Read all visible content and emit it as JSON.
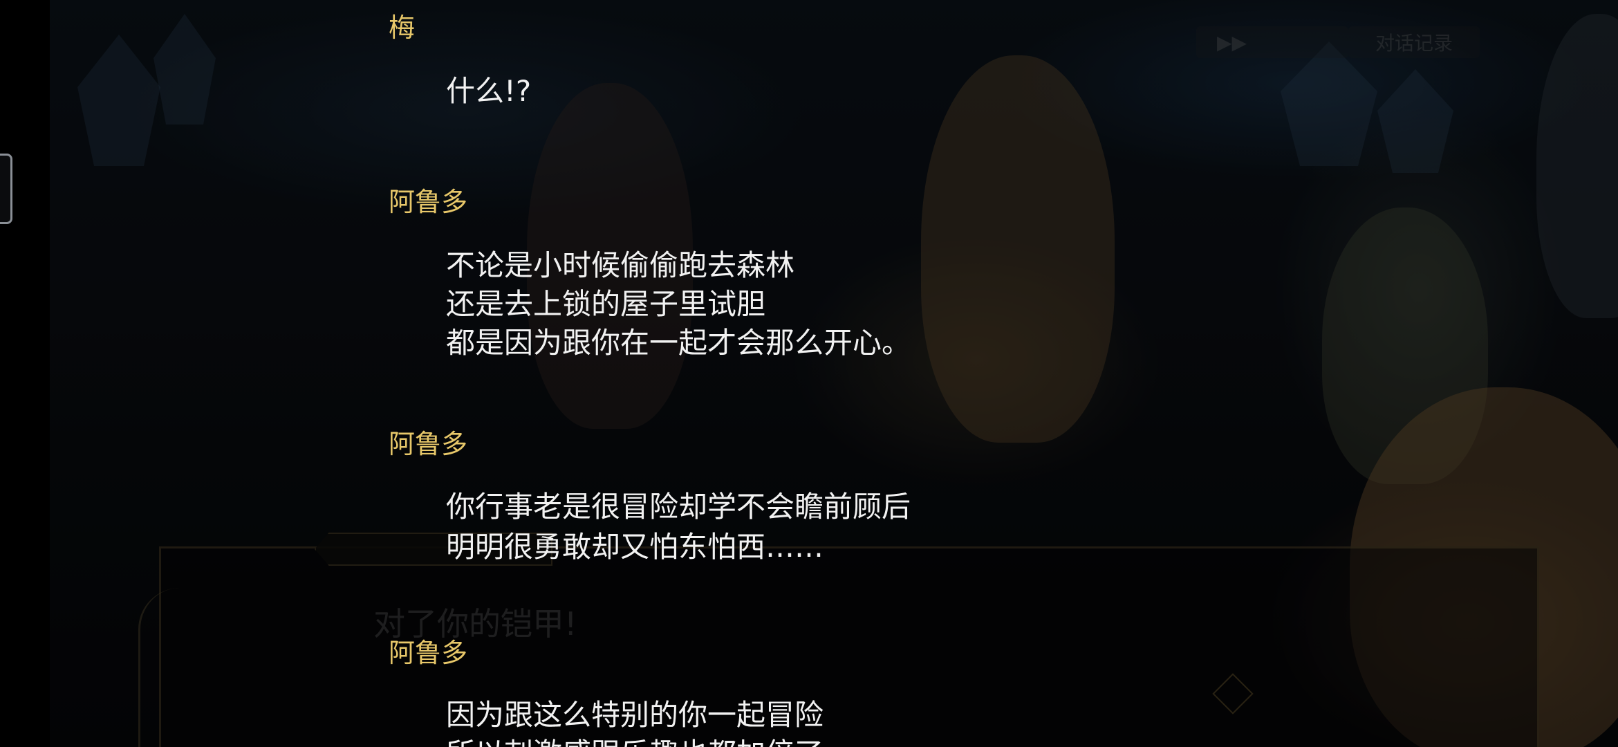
{
  "ui": {
    "skip_label": "▶▶",
    "log_label": "对话记录",
    "dialog_ghost_text": "对了你的铠甲!"
  },
  "backlog": [
    {
      "speaker": "梅",
      "lines": [
        "什么!?"
      ]
    },
    {
      "speaker": "阿鲁多",
      "lines": [
        "不论是小时候偷偷跑去森林",
        "还是去上锁的屋子里试胆",
        "都是因为跟你在一起才会那么开心。"
      ]
    },
    {
      "speaker": "阿鲁多",
      "lines": [
        "你行事老是很冒险却学不会瞻前顾后",
        "明明很勇敢却又怕东怕西……"
      ]
    },
    {
      "speaker": "阿鲁多",
      "lines": [
        "因为跟这么特别的你一起冒险",
        "所以刺激感跟乐趣也都加倍了"
      ]
    }
  ],
  "colors": {
    "speaker": "#e8c86a",
    "text": "#f2f2f2"
  }
}
